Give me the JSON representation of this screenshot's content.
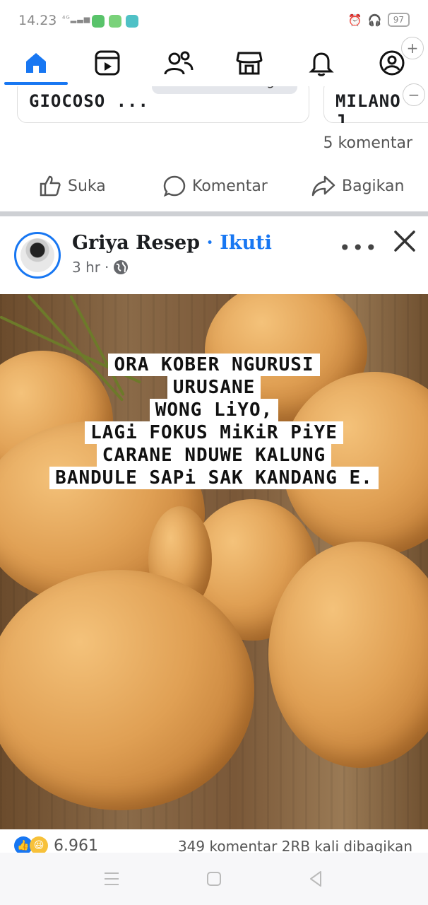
{
  "status_bar": {
    "time": "14.23",
    "signal": "4G",
    "battery": "97"
  },
  "nav": {
    "tabs": [
      "home-icon",
      "video-icon",
      "friends-icon",
      "marketplace-icon",
      "notifications-icon",
      "profile-icon"
    ],
    "active_tab": "home",
    "accent": "#1877f2"
  },
  "top_post": {
    "cards": [
      {
        "name": "GIOCOSO ...",
        "pill": "Pesan sekarang"
      },
      {
        "name": "MILANO J..."
      }
    ],
    "comment_count": "5 komentar",
    "actions": {
      "like": "Suka",
      "comment": "Komentar",
      "share": "Bagikan"
    }
  },
  "post": {
    "author": "Griya Resep",
    "separator": "·",
    "follow": "Ikuti",
    "time": "3 hr",
    "dot": "·",
    "more": "•••",
    "image_text": [
      "ORA KOBER NGURUSI",
      "URUSANE",
      "WONG LiYO,",
      "LAGi FOKUS MiKiR PiYE",
      "CARANE NDUWE KALUNG",
      "BANDULE SAPi SAK KANDANG E."
    ],
    "reaction_count": "6.961",
    "comments_shares": "349 komentar  2RB kali dibagikan"
  }
}
